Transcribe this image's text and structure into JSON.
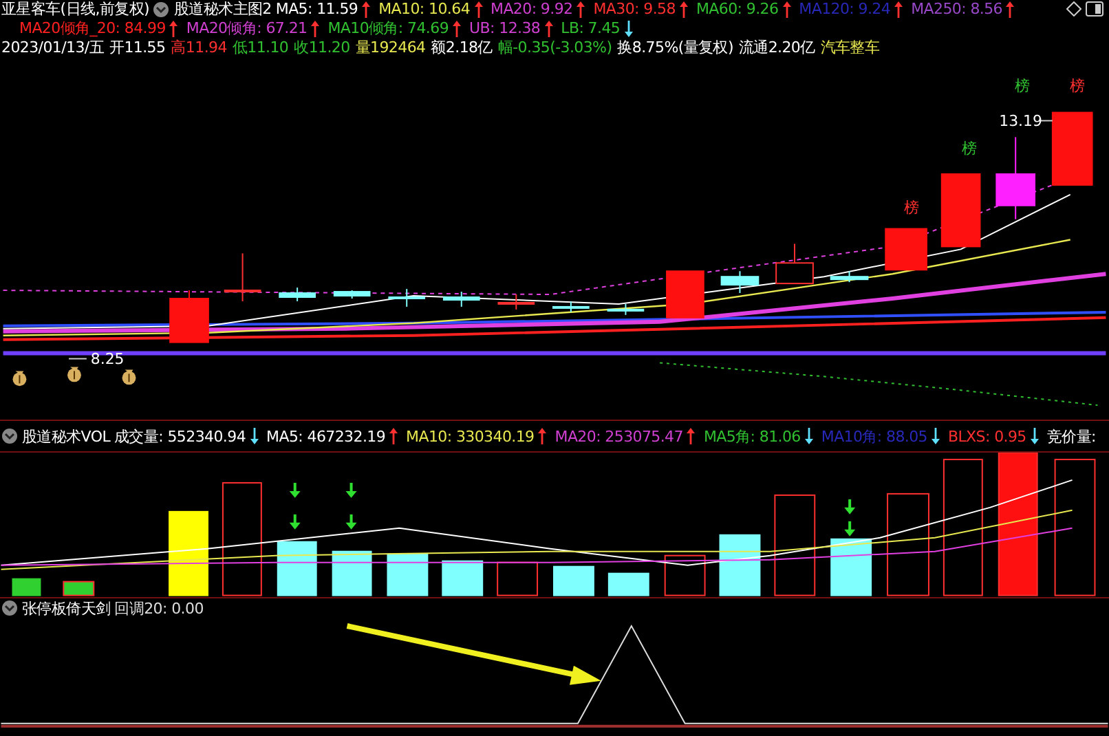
{
  "title_row": {
    "stock": "亚星客车(日线,前复权)",
    "indicator": "股道秘术主图2",
    "items": [
      {
        "text": "MA5: 11.59",
        "color": "#ffffff",
        "rising": true
      },
      {
        "text": "MA10: 10.64",
        "color": "#e8e850",
        "rising": true
      },
      {
        "text": "MA20: 9.92",
        "color": "#d040d0",
        "rising": true
      },
      {
        "text": "MA30: 9.58",
        "color": "#ff3030",
        "rising": true
      },
      {
        "text": "MA60: 9.26",
        "color": "#30c030",
        "rising": true
      },
      {
        "text": "MA120: 9.24",
        "color": "#2828b8",
        "rising": true
      },
      {
        "text": "MA250: 8.56",
        "color": "#9848c8",
        "rising": true
      }
    ]
  },
  "angle_row": {
    "items": [
      {
        "text": "MA20倾角_20: 84.99",
        "color": "#ff2020",
        "rising": true
      },
      {
        "text": "MA20倾角: 67.21",
        "color": "#d040d0",
        "rising": true
      },
      {
        "text": "MA10倾角: 74.69",
        "color": "#30c030",
        "rising": true
      },
      {
        "text": "UB: 12.38",
        "color": "#d040d0",
        "rising": true
      },
      {
        "text": "LB: 7.45",
        "color": "#30c030",
        "rising": false
      }
    ]
  },
  "quote_row": {
    "items": [
      {
        "text": "2023/01/13/五",
        "color": "#ffffff"
      },
      {
        "text": "开11.55",
        "color": "#ffffff"
      },
      {
        "text": "高11.94",
        "color": "#ff3030"
      },
      {
        "text": "低11.10",
        "color": "#30c030"
      },
      {
        "text": "收11.20",
        "color": "#30c030"
      },
      {
        "text": "量192464",
        "color": "#e8e850"
      },
      {
        "text": "额2.18亿",
        "color": "#ffffff"
      },
      {
        "text": "幅-0.35(-3.03%)",
        "color": "#30c030"
      },
      {
        "text": "换8.75%(量复权)",
        "color": "#ffffff"
      },
      {
        "text": "流通2.20亿",
        "color": "#ffffff"
      },
      {
        "text": "汽车整车",
        "color": "#e8e850"
      }
    ]
  },
  "main_chart": {
    "price_labels": [
      "8.25",
      "13.19"
    ],
    "badges": [
      {
        "text": "榜",
        "color": "#ff3030"
      },
      {
        "text": "榜",
        "color": "#30c030"
      },
      {
        "text": "榜",
        "color": "#30c030"
      },
      {
        "text": "榜",
        "color": "#ff3030"
      }
    ]
  },
  "volume_panel": {
    "indicator": "股道秘术VOL",
    "items": [
      {
        "text": "成交量: 552340.94",
        "color": "#ffffff",
        "rising": false
      },
      {
        "text": "MA5: 467232.19",
        "color": "#ffffff",
        "rising": true
      },
      {
        "text": "MA10: 330340.19",
        "color": "#e8e850",
        "rising": true
      },
      {
        "text": "MA20: 253075.47",
        "color": "#d040d0",
        "rising": true
      },
      {
        "text": "MA5角: 81.06",
        "color": "#30c030",
        "rising": false
      },
      {
        "text": "MA10角: 88.05",
        "color": "#2828b8",
        "rising": false
      },
      {
        "text": "BLXS: 0.95",
        "color": "#ff3030",
        "rising": false
      }
    ],
    "extra": "竞价量:"
  },
  "bottom_panel": {
    "indicator": "张停板倚天剑",
    "reading": "回调20: 0.00"
  }
}
